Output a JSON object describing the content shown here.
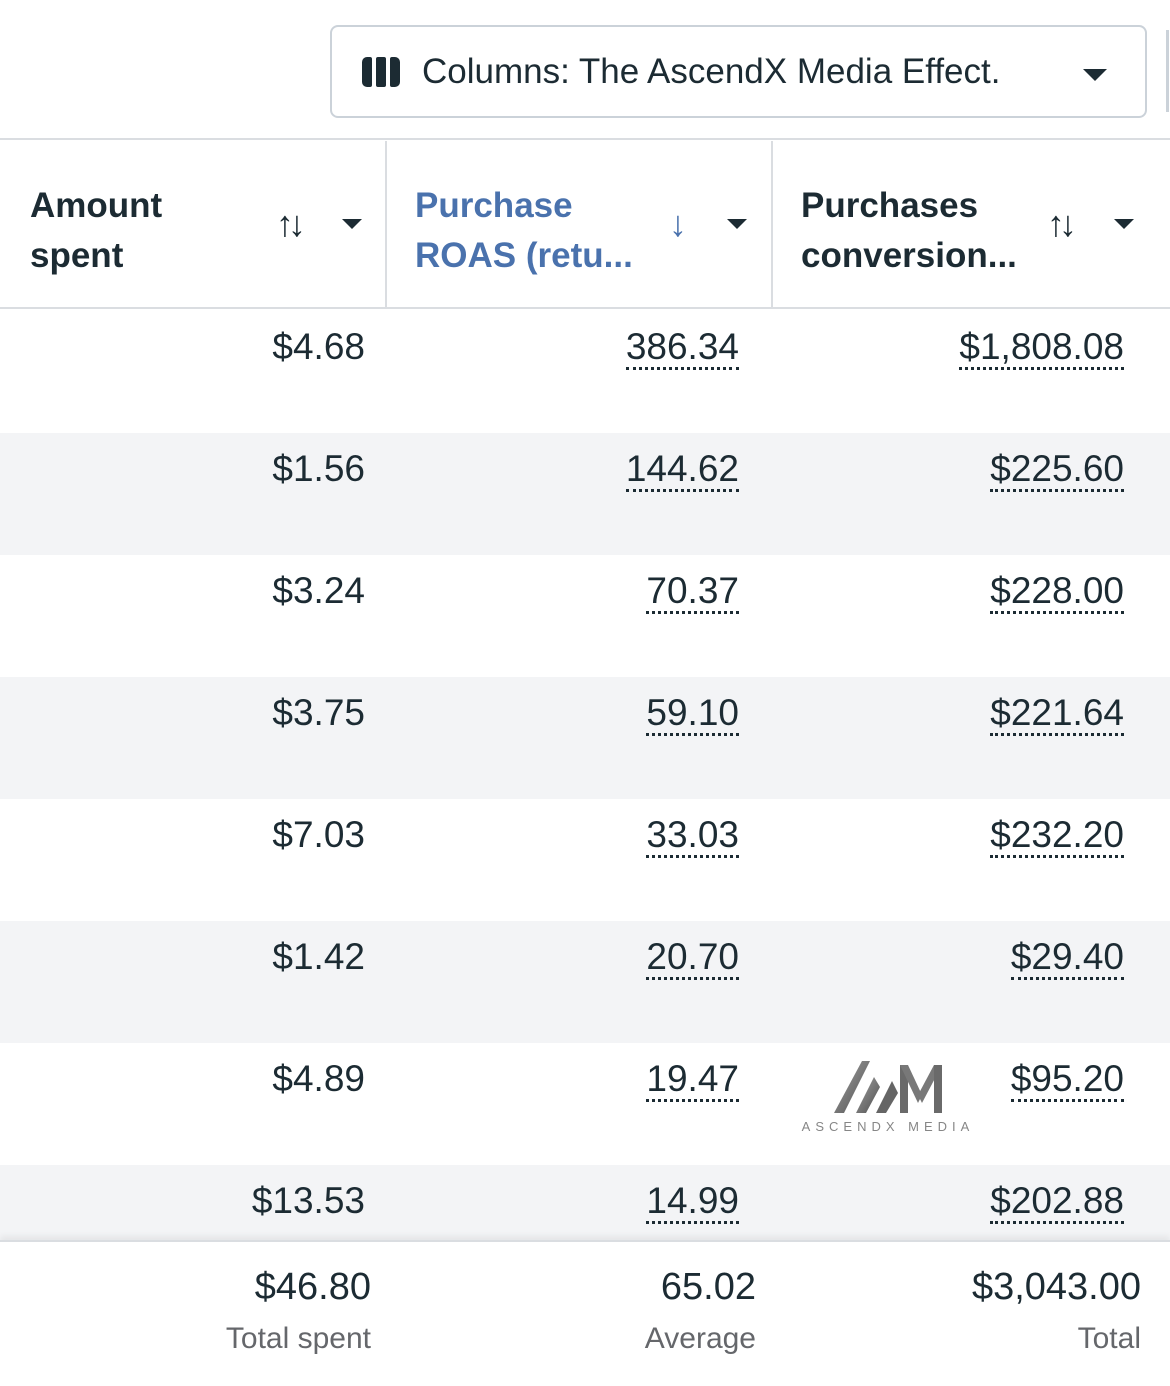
{
  "toolbar": {
    "columns_label": "Columns: The AscendX Media Effect."
  },
  "table": {
    "headers": [
      {
        "title_line1": "Amount",
        "title_line2": "spent",
        "sort": "↑↓"
      },
      {
        "title_line1": "Purchase",
        "title_line2": "ROAS (retu...",
        "sort": "↓"
      },
      {
        "title_line1": "Purchases",
        "title_line2": "conversion...",
        "sort": "↑↓"
      }
    ],
    "rows": [
      {
        "amount": "$4.68",
        "roas": "386.34",
        "conv": "$1,808.08"
      },
      {
        "amount": "$1.56",
        "roas": "144.62",
        "conv": "$225.60"
      },
      {
        "amount": "$3.24",
        "roas": "70.37",
        "conv": "$228.00"
      },
      {
        "amount": "$3.75",
        "roas": "59.10",
        "conv": "$221.64"
      },
      {
        "amount": "$7.03",
        "roas": "33.03",
        "conv": "$232.20"
      },
      {
        "amount": "$1.42",
        "roas": "20.70",
        "conv": "$29.40"
      },
      {
        "amount": "$4.89",
        "roas": "19.47",
        "conv": "$95.20"
      },
      {
        "amount": "$13.53",
        "roas": "14.99",
        "conv": "$202.88"
      }
    ],
    "footer": {
      "amount_total": "$46.80",
      "amount_label": "Total spent",
      "roas_total": "65.02",
      "roas_label": "Average",
      "conv_total": "$3,043.00",
      "conv_label": "Total"
    }
  },
  "watermark": {
    "text": "ASCENDX MEDIA",
    "color": "#6e6e6e"
  },
  "colors": {
    "accent": "#4a72ad",
    "text": "#1c2b33",
    "alt_row": "#f3f4f6",
    "muted": "#65676b"
  }
}
